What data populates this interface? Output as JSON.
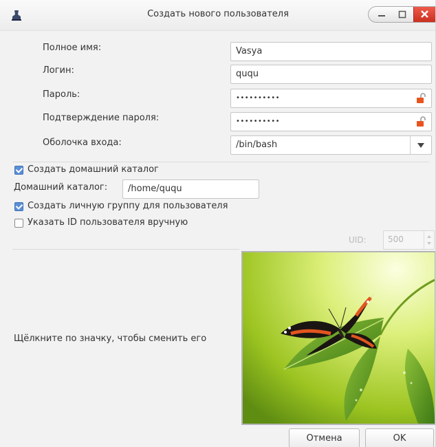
{
  "window": {
    "title": "Создать нового пользователя"
  },
  "form": {
    "fullname_label": "Полное имя:",
    "fullname_value": "Vasya",
    "login_label": "Логин:",
    "login_value": "ququ",
    "password_label": "Пароль:",
    "password_value": "••••••••••",
    "confirm_label": "Подтверждение пароля:",
    "confirm_value": "••••••••••",
    "shell_label": "Оболочка входа:",
    "shell_value": "/bin/bash"
  },
  "options": {
    "create_home_label": "Создать домашний каталог",
    "create_home_checked": true,
    "home_dir_label": "Домашний каталог:",
    "home_dir_value": "/home/ququ",
    "create_group_label": "Создать личную группу для пользователя",
    "create_group_checked": true,
    "manual_uid_label": "Указать ID пользователя вручную",
    "manual_uid_checked": false,
    "uid_label": "UID:",
    "uid_value": "500"
  },
  "avatar": {
    "hint": "Щёлкните по значку, чтобы сменить его"
  },
  "buttons": {
    "cancel": "Отмена",
    "ok": "OK"
  },
  "colors": {
    "checkbox_accent": "#5b8fd6",
    "close_button": "#d93b2b",
    "lock_icon": "#e8541e"
  }
}
